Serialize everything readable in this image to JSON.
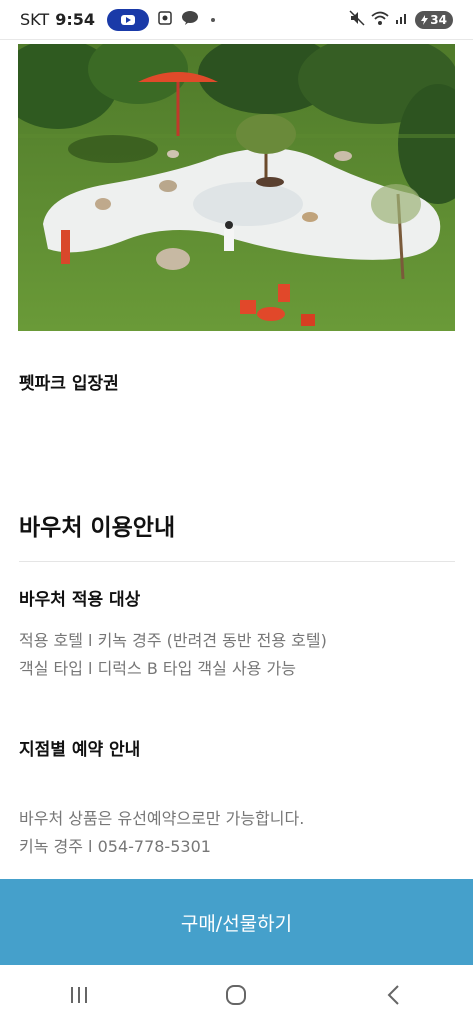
{
  "status_bar": {
    "carrier": "SKT",
    "time": "9:54",
    "battery": "34",
    "icons": [
      "youtube-icon",
      "screenshot-icon",
      "talk-icon",
      "mute-icon",
      "wifi-icon",
      "signal-icon",
      "battery-icon"
    ]
  },
  "hero": {
    "alt_icon": "park-photo"
  },
  "product": {
    "title": "펫파크 입장권"
  },
  "guide": {
    "title": "바우처 이용안내",
    "target": {
      "title": "바우처 적용 대상",
      "lines": [
        "적용 호텔 l 키녹 경주 (반려견 동반 전용 호텔)",
        "객실 타입 l 디럭스 B 타입 객실 사용 가능"
      ]
    },
    "reservation": {
      "title": "지점별 예약 안내",
      "lines": [
        "바우처 상품은 유선예약으로만 가능합니다.",
        "키녹 경주 l 054-778-5301"
      ]
    }
  },
  "cta": {
    "label": "구매/선물하기",
    "color": "#45a0cb"
  },
  "nav": {
    "icons": [
      "recent-apps-icon",
      "home-icon",
      "back-icon"
    ]
  }
}
